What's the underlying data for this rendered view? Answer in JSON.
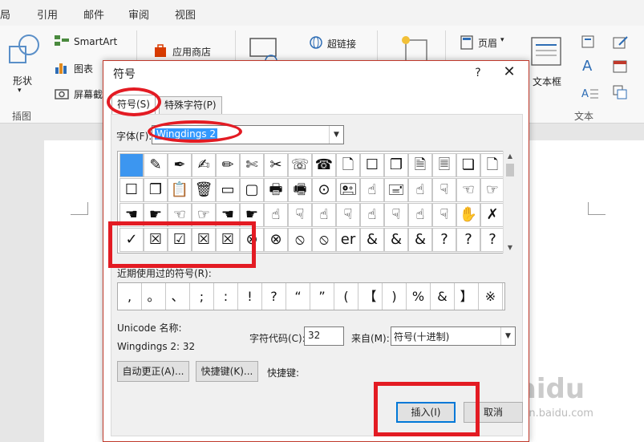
{
  "ribbon_tabs": [
    "局",
    "引用",
    "邮件",
    "审阅",
    "视图"
  ],
  "ribbon": {
    "shapes_label": "形状",
    "smartart_label": "SmartArt",
    "chart_label": "图表",
    "screenshot_label": "屏幕截",
    "store_label": "应用商店",
    "hyperlink_label": "超链接",
    "header_label": "页眉",
    "textbox_label": "文本框",
    "group_illustrations": "插图",
    "group_text": "文本"
  },
  "dialog": {
    "title": "符号",
    "help": "?",
    "close": "✕",
    "tabs": [
      "符号(S)",
      "特殊字符(P)"
    ],
    "font_label": "字体(F):",
    "font_value": "Wingdings 2",
    "symbol_rows": [
      [
        "",
        "✎",
        "✒",
        "✍",
        "✏",
        "✄",
        "✂",
        "☏",
        "☎",
        "🗋",
        "☐",
        "❐",
        "🗎",
        "🗏",
        "❏",
        "🗋"
      ],
      [
        "☐",
        "❐",
        "📋",
        "🗑",
        "▭",
        "▢",
        "🖶",
        "🖷",
        "⊙",
        "🖭",
        "☝",
        "🖃",
        "☝",
        "☟",
        "☜",
        "☞"
      ],
      [
        "☚",
        "☛",
        "☜",
        "☞",
        "☚",
        "☛",
        "☝",
        "☟",
        "☝",
        "☟",
        "☝",
        "☟",
        "☝",
        "☟",
        "✋",
        "✗"
      ],
      [
        "✓",
        "☒",
        "☑",
        "☒",
        "☒",
        "⊗",
        "⊗",
        "⦸",
        "⦸",
        "er",
        "&",
        "&",
        "&",
        "?",
        "?",
        "?"
      ]
    ],
    "recent_label": "近期使用过的符号(R):",
    "recent_symbols": [
      ",",
      "。",
      "、",
      ";",
      ":",
      "!",
      "?",
      "“",
      "”",
      "(",
      "【",
      ")",
      "%",
      "&",
      "】",
      "※"
    ],
    "unicode_name_label": "Unicode 名称:",
    "unicode_name_value": "Wingdings 2: 32",
    "char_code_label": "字符代码(C):",
    "char_code_value": "32",
    "from_label": "来自(M):",
    "from_value": "符号(十进制)",
    "autocorrect_button": "自动更正(A)...",
    "shortcut_key_button": "快捷键(K)...",
    "shortcut_key_label": "快捷键:",
    "insert_button": "插入(I)",
    "cancel_button": "取消"
  },
  "watermark": {
    "text": "Baidu",
    "sub": "jingyan.baidu.com"
  },
  "colors": {
    "annotation": "#e31b23",
    "selection": "#3c96f0",
    "dialog_border": "#c0392b"
  }
}
